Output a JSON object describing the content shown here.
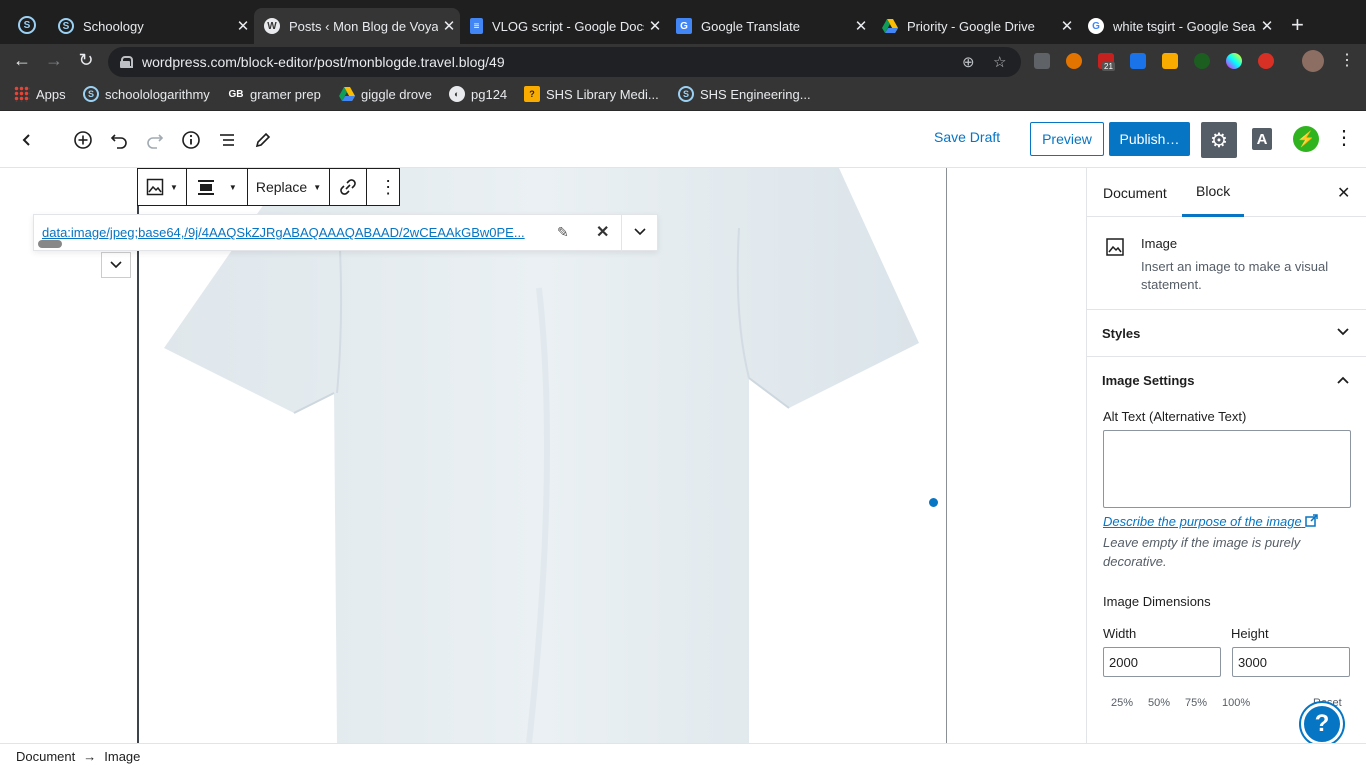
{
  "browser": {
    "tabs": [
      {
        "title": "Schoology",
        "icon": "schoology-icon",
        "active": false
      },
      {
        "title": "Posts ‹ Mon Blog de Voyage",
        "icon": "wordpress-icon",
        "active": true
      },
      {
        "title": "VLOG script - Google Docs",
        "icon": "google-docs-icon",
        "active": false
      },
      {
        "title": "Google Translate",
        "icon": "google-translate-icon",
        "active": false
      },
      {
        "title": "Priority - Google Drive",
        "icon": "google-drive-icon",
        "active": false
      },
      {
        "title": "white tsgirt - Google Search",
        "icon": "google-icon",
        "active": false
      }
    ],
    "url": "wordpress.com/block-editor/post/monblogde.travel.blog/49",
    "bookmarks": [
      {
        "label": "Apps",
        "icon": "apps-grid-icon"
      },
      {
        "label": "schoolologarithmy",
        "icon": "schoology-icon"
      },
      {
        "label": "gramer prep",
        "icon": "gb-icon"
      },
      {
        "label": "giggle drove",
        "icon": "google-drive-icon"
      },
      {
        "label": "pg124",
        "icon": "globe-icon"
      },
      {
        "label": "SHS Library Medi...",
        "icon": "library-icon"
      },
      {
        "label": "SHS Engineering...",
        "icon": "schoology-icon"
      }
    ],
    "extension_badge": "21"
  },
  "editor": {
    "save_draft": "Save Draft",
    "preview": "Preview",
    "publish": "Publish…",
    "typography_letter": "A",
    "block_toolbar": {
      "replace": "Replace"
    },
    "image_url": "data:image/jpeg;base64,/9j/4AAQSkZJRgABAQAAAQABAAD/2wCEAAkGBw0PE..."
  },
  "sidebar": {
    "tabs": [
      "Document",
      "Block"
    ],
    "active_tab": "Block",
    "block_title": "Image",
    "block_description": "Insert an image to make a visual statement.",
    "styles_label": "Styles",
    "image_settings_label": "Image Settings",
    "alt_text_label": "Alt Text (Alternative Text)",
    "alt_text_value": "",
    "describe_link": "Describe the purpose of the image",
    "help_text": "Leave empty if the image is purely decorative.",
    "dimensions_label": "Image Dimensions",
    "width_label": "Width",
    "height_label": "Height",
    "width_value": "2000",
    "height_value": "3000",
    "percent_options": [
      "25%",
      "50%",
      "75%",
      "100%"
    ],
    "reset_label": "Reset"
  },
  "footer": {
    "breadcrumb": [
      "Document",
      "Image"
    ]
  },
  "colors": {
    "accent": "#0675c4",
    "chrome_dark": "#1f1f1f",
    "chrome_toolbar": "#353535",
    "jetpack_green": "#2fb41f"
  }
}
